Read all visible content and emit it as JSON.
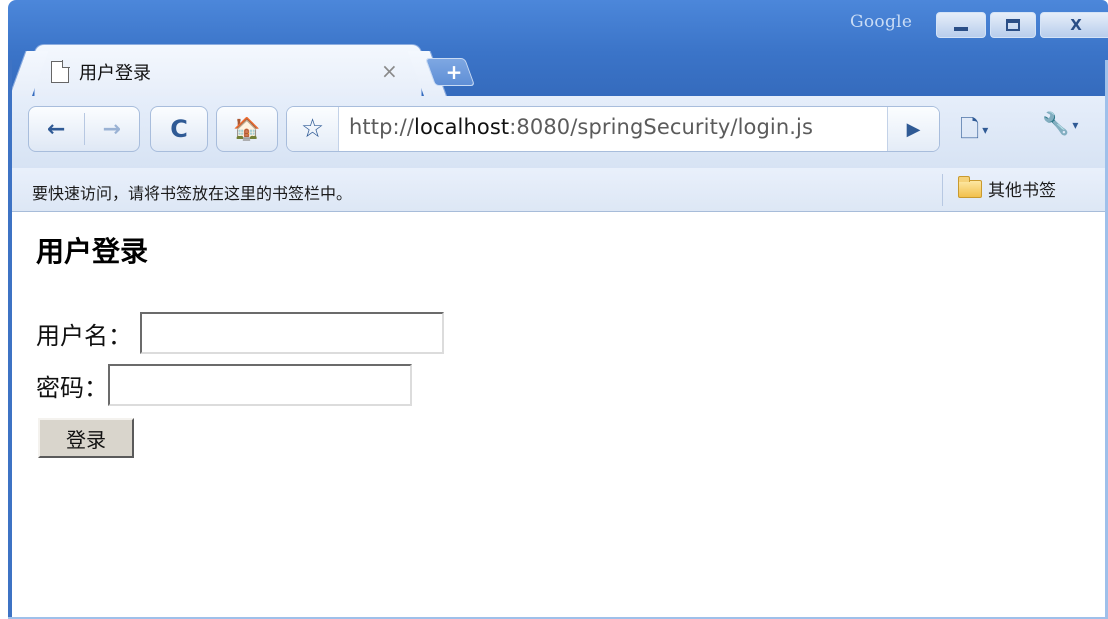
{
  "window": {
    "brand": "Google",
    "minimize_label": "",
    "maximize_label": "",
    "close_label": "X"
  },
  "tab": {
    "title": "用户登录",
    "close_label": "×",
    "new_tab_label": "+"
  },
  "toolbar": {
    "back_label": "←",
    "forward_label": "→",
    "reload_label": "C",
    "home_label": "🏠",
    "star_label": "☆",
    "go_label": "▶",
    "page_menu_label": "🗋",
    "tools_menu_label": "🔧",
    "dropdown_arrow": "▾"
  },
  "address_bar": {
    "scheme": "http://",
    "host": "localhost",
    "rest": ":8080/springSecurity/login.js"
  },
  "bookmarks": {
    "hint": "要快速访问，请将书签放在这里的书签栏中。",
    "other_label": "其他书签"
  },
  "page": {
    "heading": "用户登录",
    "username_label": "用户名：",
    "username_value": "",
    "password_label": "密码：",
    "password_value": "",
    "submit_label": "登录"
  },
  "colors": {
    "frame": "#3b74c8",
    "toolbar": "#dce6f5",
    "page_bg": "#ffffff"
  }
}
